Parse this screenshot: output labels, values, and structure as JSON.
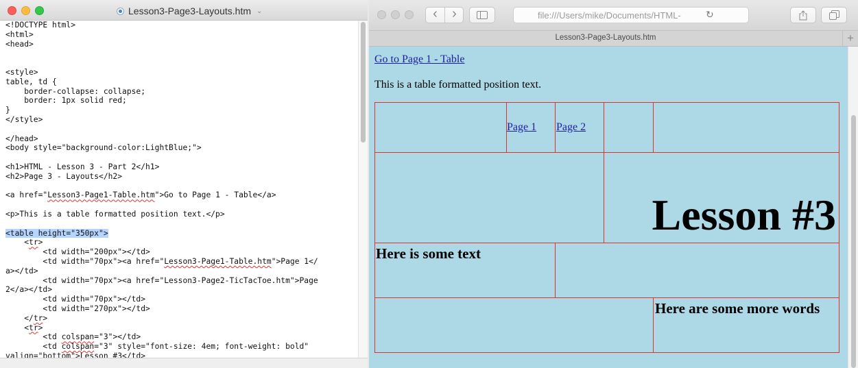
{
  "editor": {
    "filename": "Lesson3-Page3-Layouts.htm",
    "filename_chevron": "⌄",
    "code_lines": [
      [
        {
          "t": "<!DOCTYPE html>"
        }
      ],
      [
        {
          "t": "<html>"
        }
      ],
      [
        {
          "t": "<head>"
        }
      ],
      [
        {
          "t": ""
        }
      ],
      [
        {
          "t": ""
        }
      ],
      [
        {
          "t": "<style>"
        }
      ],
      [
        {
          "t": "table, td {"
        }
      ],
      [
        {
          "t": "    border-collapse: collapse;"
        }
      ],
      [
        {
          "t": "    border: 1px solid red;"
        }
      ],
      [
        {
          "t": "}"
        }
      ],
      [
        {
          "t": "</style>"
        }
      ],
      [
        {
          "t": ""
        }
      ],
      [
        {
          "t": "</head>"
        }
      ],
      [
        {
          "t": "<body style=\"background-color:LightBlue;\">"
        }
      ],
      [
        {
          "t": ""
        }
      ],
      [
        {
          "t": "<h1>HTML - Lesson 3 - Part 2</h1>"
        }
      ],
      [
        {
          "t": "<h2>Page 3 - Layouts</h2>"
        }
      ],
      [
        {
          "t": ""
        }
      ],
      [
        {
          "t": "<a href=\""
        },
        {
          "t": "Lesson3-Page1-Table.htm",
          "s": "squig"
        },
        {
          "t": "\">Go to Page 1 - Table</a>"
        }
      ],
      [
        {
          "t": ""
        }
      ],
      [
        {
          "t": "<p>This is a table formatted position text.</p>"
        }
      ],
      [
        {
          "t": ""
        }
      ],
      [
        {
          "t": "<table height=\"350px\">",
          "s": "sel"
        }
      ],
      [
        {
          "t": "    <"
        },
        {
          "t": "tr",
          "s": "squig"
        },
        {
          "t": ">"
        }
      ],
      [
        {
          "t": "        <td width=\"200px\"></td>"
        }
      ],
      [
        {
          "t": "        <td width=\"70px\"><a href=\""
        },
        {
          "t": "Lesson3-Page1-Table.htm",
          "s": "squig"
        },
        {
          "t": "\">Page 1</"
        }
      ],
      [
        {
          "t": "a></td>"
        }
      ],
      [
        {
          "t": "        <td width=\"70px\"><a href=\"Lesson3-Page2-TicTacToe.htm\">Page"
        }
      ],
      [
        {
          "t": "2</a></td>"
        }
      ],
      [
        {
          "t": "        <td width=\"70px\"></td>"
        }
      ],
      [
        {
          "t": "        <td width=\"270px\"></td>"
        }
      ],
      [
        {
          "t": "    </"
        },
        {
          "t": "tr",
          "s": "squig"
        },
        {
          "t": ">"
        }
      ],
      [
        {
          "t": "    <"
        },
        {
          "t": "tr",
          "s": "squig"
        },
        {
          "t": ">"
        }
      ],
      [
        {
          "t": "        <td "
        },
        {
          "t": "colspan",
          "s": "squig"
        },
        {
          "t": "=\"3\"></td>"
        }
      ],
      [
        {
          "t": "        <td "
        },
        {
          "t": "colspan",
          "s": "squig"
        },
        {
          "t": "=\"3\" style=\"font-size: 4em; font-weight: bold\""
        }
      ],
      [
        {
          "t": "valign",
          "s": "squig"
        },
        {
          "t": "=\"bottom\">Lesson #3</td>"
        }
      ]
    ]
  },
  "browser": {
    "back_icon": "‹",
    "forward_icon": "›",
    "sidebar_icon": "sidebar-icon",
    "address": "file:///Users/mike/Documents/HTML-",
    "reload_icon": "↻",
    "share_icon": "share-icon",
    "tabs_icon": "tabs-icon",
    "tab_title": "Lesson3-Page3-Layouts.htm",
    "new_tab": "+",
    "page": {
      "background_color": "#add8e6",
      "link_page1": "Go to Page 1 - Table",
      "paragraph": "This is a table formatted position text.",
      "table_border_color": "#e23030",
      "page1_link": "Page 1",
      "page2_link": "Page 2",
      "lesson_heading": "Lesson #3",
      "some_text": "Here is some text",
      "more_words": "Here are some more words"
    }
  }
}
